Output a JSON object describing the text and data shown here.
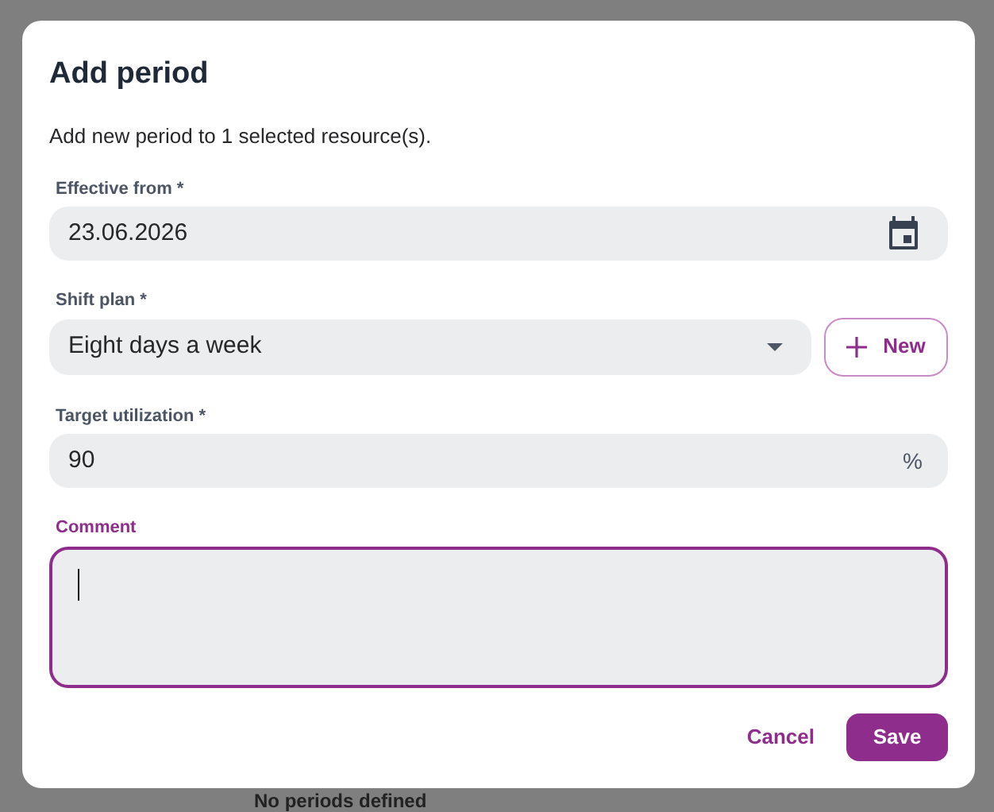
{
  "background": {
    "empty_text": "No periods defined"
  },
  "dialog": {
    "title": "Add period",
    "description": "Add new period to 1 selected resource(s).",
    "fields": [
      {
        "kind": "date",
        "label": "Effective from *",
        "value": "23.06.2026"
      },
      {
        "kind": "select",
        "label": "Shift plan *",
        "value": "Eight days a week",
        "button": {
          "label": "New"
        }
      },
      {
        "kind": "number",
        "label": "Target utilization *",
        "value": "90",
        "suffix": "%"
      },
      {
        "kind": "textarea",
        "label": "Comment",
        "focused": true
      }
    ],
    "buttons": [
      {
        "label": "Cancel",
        "kind": "text"
      },
      {
        "label": "Save",
        "kind": "primary"
      }
    ]
  }
}
